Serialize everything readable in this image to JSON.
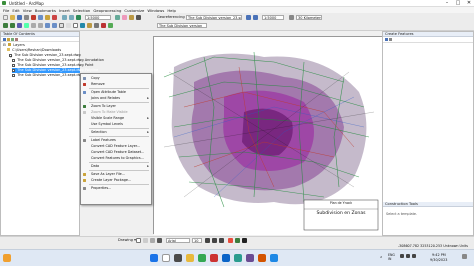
{
  "window": {
    "title": "Untitled - ArcMap",
    "min": "–",
    "max": "□",
    "close": "✕"
  },
  "menu": [
    "File",
    "Edit",
    "View",
    "Bookmarks",
    "Insert",
    "Selection",
    "Geoprocessing",
    "Customize",
    "Windows",
    "Help"
  ],
  "toolbar": {
    "georef_label": "Georeferencing",
    "layer_dd": "The Sub Division version_23.sept",
    "layer_dd2": "The Sub Division version",
    "scale_dd": "1:5000",
    "coord_dd": "30 Kilometers"
  },
  "toc": {
    "title": "Table Of Contents",
    "root": "Layers",
    "folder": "C:\\Users\\Reshan\\Downloads",
    "layers": [
      "The Sub Division version_23.sept.dwg",
      "The Sub Division version_23.sept.dwg Annotation",
      "The Sub Division version_23.sept.dwg Point",
      "The Sub Division version_23.sept.dwg Polyline",
      "The Sub Division version_23.sept.dwg MultiPatch"
    ]
  },
  "context_menu": {
    "items": [
      {
        "label": "Copy",
        "icon_color": "#7a8fb0"
      },
      {
        "label": "Remove",
        "icon_color": "#c0392b"
      },
      {
        "label": "Open Attribute Table",
        "icon_color": "#6a8ec6"
      },
      {
        "label": "Joins and Relates",
        "icon_color": ""
      },
      {
        "label": "Zoom To Layer",
        "icon_color": "#3c7d3c"
      },
      {
        "label": "Zoom To Make Visible",
        "icon_color": "#a8a8a8"
      },
      {
        "label": "Visible Scale Range",
        "icon_color": ""
      },
      {
        "label": "Use Symbol Levels",
        "icon_color": ""
      },
      {
        "label": "Selection",
        "icon_color": ""
      },
      {
        "label": "Label Features",
        "icon_color": "#888"
      },
      {
        "label": "Convert CAD Feature Layer...",
        "icon_color": ""
      },
      {
        "label": "Convert CAD Feature Dataset...",
        "icon_color": ""
      },
      {
        "label": "Convert Features to Graphics...",
        "icon_color": ""
      },
      {
        "label": "Data",
        "icon_color": ""
      },
      {
        "label": "Save As Layer File...",
        "icon_color": "#caa33a"
      },
      {
        "label": "Create Layer Package...",
        "icon_color": "#caa33a"
      },
      {
        "label": "Properties...",
        "icon_color": "#888"
      }
    ]
  },
  "map": {
    "caption_small": "Plan de Ynock",
    "caption_big": "Subdivision en Zonas"
  },
  "create_features": {
    "title": "Create Features",
    "tools_title": "Construction Tools",
    "tools_hint": "Select a template."
  },
  "drawbar": {
    "drawing": "Drawing ▾",
    "font": "Arial",
    "size": "10"
  },
  "status": {
    "coords": "-308607.782  3253120.253 Unknown Units"
  },
  "taskbar": {
    "lang": "ENG\nIN",
    "time": "9:42 PM",
    "date": "9/30/2023"
  },
  "colors": {
    "accent": "#0a64c8",
    "selected_row": "#3399ff"
  }
}
